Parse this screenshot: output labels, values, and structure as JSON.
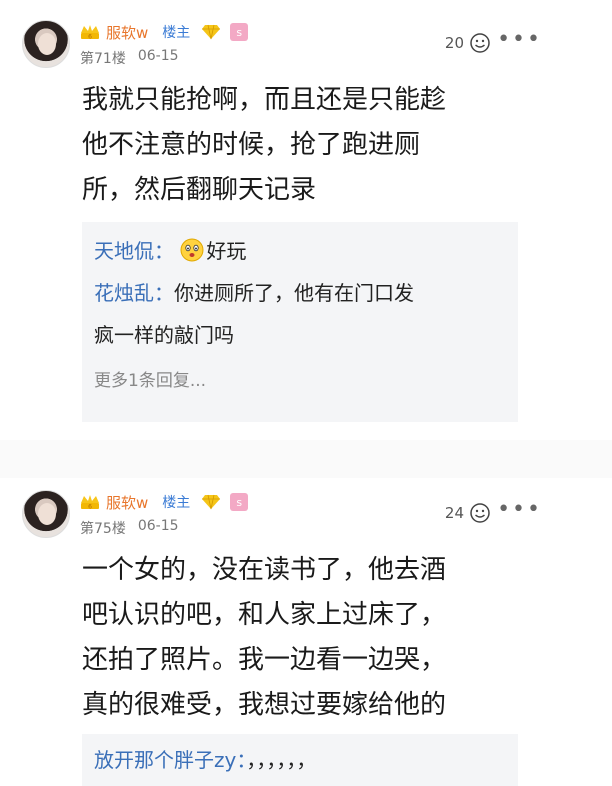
{
  "posts": [
    {
      "username": "服软w",
      "owner_tag": "楼主",
      "vip": "s",
      "floor": "第71楼",
      "date": "06-15",
      "likes": "20",
      "more": "•••",
      "content": [
        "我就只能抢啊，而且还是只能趁",
        "他不注意的时候，抢了跑进厕",
        "所，然后翻聊天记录"
      ],
      "replies": [
        {
          "name": "天地侃",
          "sep": "：",
          "text": "好玩",
          "has_emoji": true
        },
        {
          "name": "花烛乱",
          "sep": "：",
          "text": "你进厕所了，他有在门口发",
          "text2": "疯一样的敲门吗"
        }
      ],
      "more_replies": "更多1条回复..."
    },
    {
      "username": "服软w",
      "owner_tag": "楼主",
      "vip": "s",
      "floor": "第75楼",
      "date": "06-15",
      "likes": "24",
      "more": "•••",
      "content": [
        "一个女的，没在读书了，他去酒",
        "吧认识的吧，和人家上过床了，",
        "还拍了照片。我一边看一边哭，",
        "真的很难受，我想过要嫁给他的"
      ],
      "replies": [
        {
          "name": "放开那个胖子zy",
          "sep": "：",
          "text": "，，，，，，"
        }
      ]
    }
  ],
  "colors": {
    "username": "#e8762c",
    "owner_tag": "#3a7bd5",
    "reply_name": "#3a6fb8"
  }
}
